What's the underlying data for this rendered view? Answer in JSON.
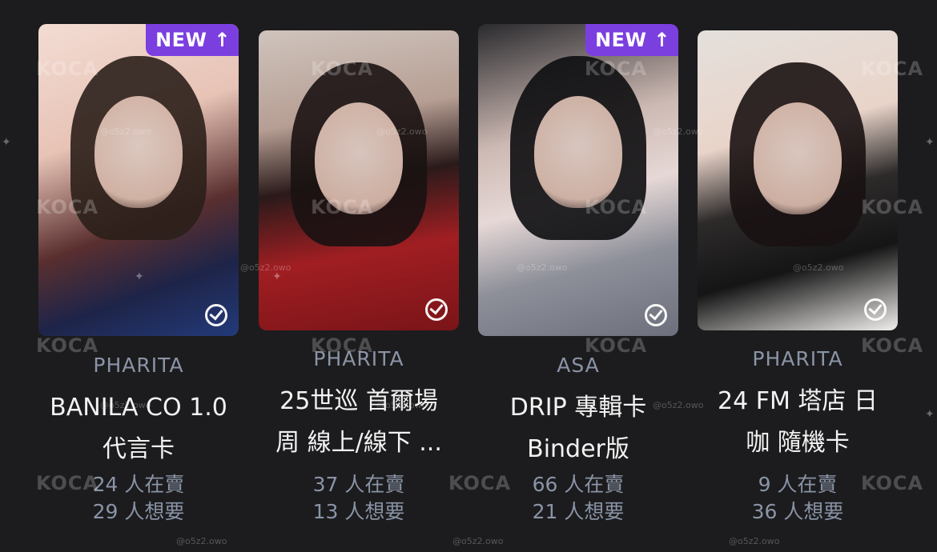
{
  "cards": [
    {
      "badge": "NEW ↑",
      "group": "PHARITA",
      "title": "BANILA CO 1.0\n代言卡",
      "selling": "24 人在賣",
      "wanting": "29 人想要"
    },
    {
      "badge": "",
      "group": "PHARITA",
      "title": "25世巡 首爾場\n周 線上/線下 ...",
      "selling": "37 人在賣",
      "wanting": "13 人想要"
    },
    {
      "badge": "NEW ↑",
      "group": "ASA",
      "title": "DRIP 專輯卡\nBinder版",
      "selling": "66 人在賣",
      "wanting": "21 人想要"
    },
    {
      "badge": "",
      "group": "PHARITA",
      "title": "24 FM 塔店 日\n咖 隨機卡",
      "selling": "9 人在賣",
      "wanting": "36 人想要"
    }
  ],
  "watermark": {
    "brand": "KOCA",
    "handle": "@o5z2.owo"
  },
  "colors": {
    "background": "#1c1c1e",
    "badge": "#7b3fe0",
    "muted_text": "#8a94a6",
    "title_text": "#f2f2f2"
  },
  "icons": {
    "check": "check-circle-icon",
    "arrow": "arrow-up-icon"
  }
}
